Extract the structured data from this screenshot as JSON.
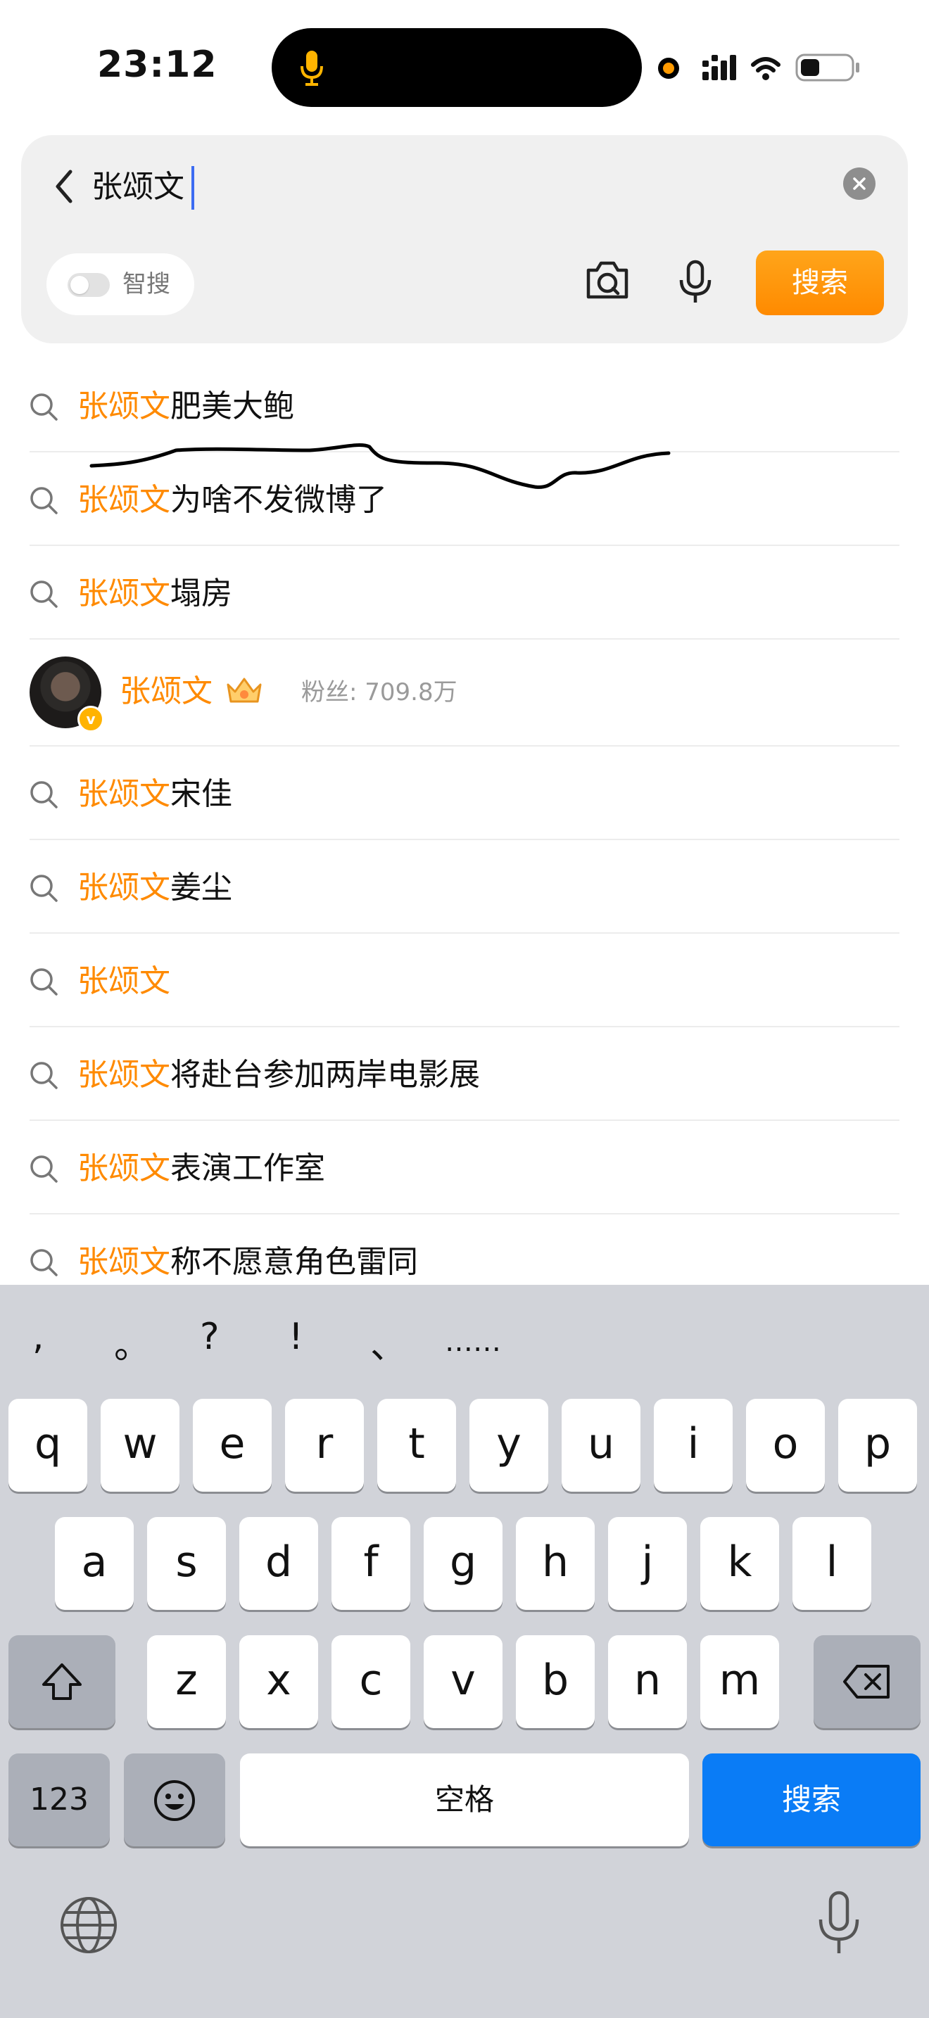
{
  "status": {
    "time": "23:12"
  },
  "search": {
    "query": "张颂文",
    "smart_label": "智搜",
    "button": "搜索"
  },
  "suggestions": [
    {
      "type": "query",
      "highlight": "张颂文",
      "rest": "肥美大鲍"
    },
    {
      "type": "query",
      "highlight": "张颂文",
      "rest": "为啥不发微博了"
    },
    {
      "type": "query",
      "highlight": "张颂文",
      "rest": "塌房"
    },
    {
      "type": "user",
      "name": "张颂文",
      "fans": "粉丝: 709.8万"
    },
    {
      "type": "query",
      "highlight": "张颂文",
      "rest": "宋佳"
    },
    {
      "type": "query",
      "highlight": "张颂文",
      "rest": "姜尘"
    },
    {
      "type": "query",
      "highlight": "张颂文",
      "rest": ""
    },
    {
      "type": "query",
      "highlight": "张颂文",
      "rest": "将赴台参加两岸电影展"
    },
    {
      "type": "query",
      "highlight": "张颂文",
      "rest": "表演工作室"
    },
    {
      "type": "query",
      "highlight": "张颂文",
      "rest": "称不愿意角色雷同"
    }
  ],
  "keyboard": {
    "punctuation": [
      ",",
      "。",
      "?",
      "!",
      "、",
      "……"
    ],
    "row1": [
      "q",
      "w",
      "e",
      "r",
      "t",
      "y",
      "u",
      "i",
      "o",
      "p"
    ],
    "row2": [
      "a",
      "s",
      "d",
      "f",
      "g",
      "h",
      "j",
      "k",
      "l"
    ],
    "row3": [
      "z",
      "x",
      "c",
      "v",
      "b",
      "n",
      "m"
    ],
    "numbers_key": "123",
    "space_key": "空格",
    "search_key": "搜索"
  },
  "colors": {
    "highlight": "#ff8a00",
    "search_button": "#ff9a00",
    "keyboard_search": "#0a7cf6"
  }
}
